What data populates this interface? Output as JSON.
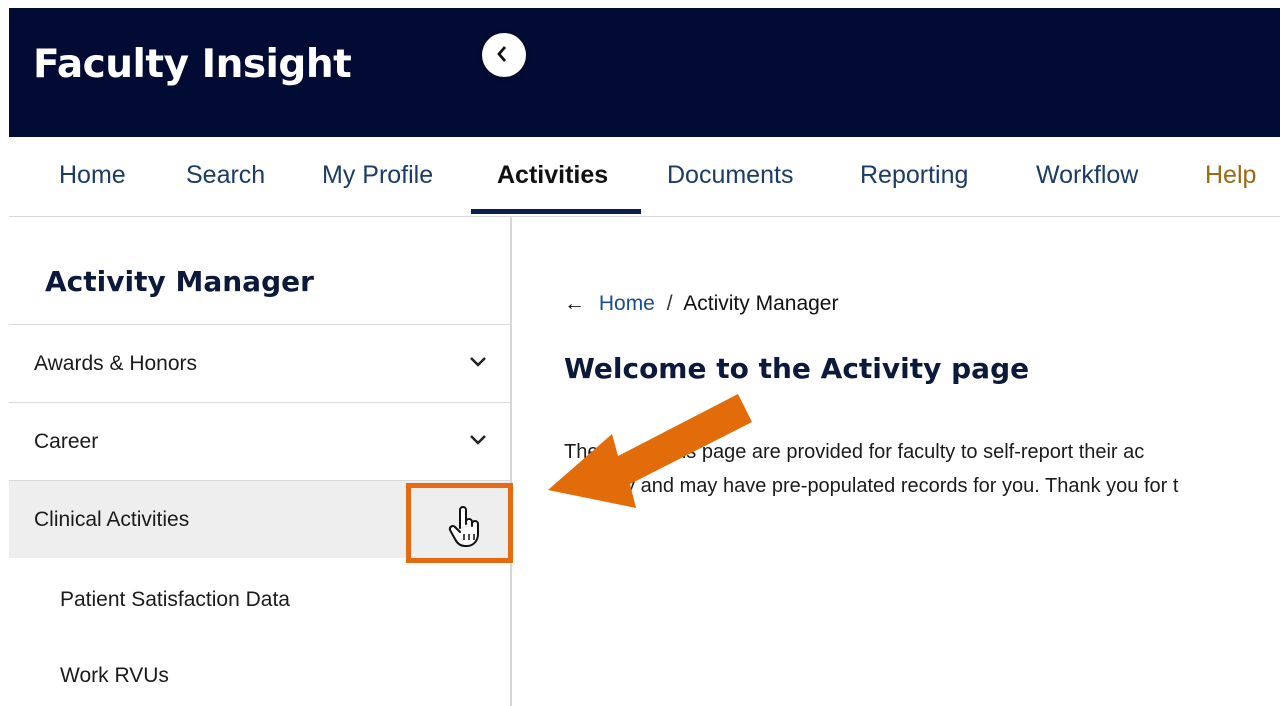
{
  "app": {
    "title": "Faculty Insight"
  },
  "nav": {
    "items": [
      {
        "label": "Home"
      },
      {
        "label": "Search"
      },
      {
        "label": "My Profile"
      },
      {
        "label": "Activities"
      },
      {
        "label": "Documents"
      },
      {
        "label": "Reporting"
      },
      {
        "label": "Workflow"
      },
      {
        "label": "Help"
      }
    ],
    "active": "Activities"
  },
  "sidebar": {
    "title": "Activity Manager",
    "collapse_icon": "chevron-left-icon",
    "items": [
      {
        "label": "Awards & Honors",
        "icon": "chevron-down-icon"
      },
      {
        "label": "Career",
        "icon": "chevron-down-icon"
      },
      {
        "label": "Clinical Activities",
        "icon": "hand-pointer-icon"
      }
    ],
    "subitems": [
      {
        "label": "Patient Satisfaction Data"
      },
      {
        "label": "Work RVUs"
      }
    ]
  },
  "breadcrumb": {
    "back_icon": "←",
    "home": "Home",
    "separator": "/",
    "current": "Activity Manager"
  },
  "main": {
    "heading": "Welcome to the Activity page",
    "intro_line1": "The f           his page are provided for faculty to self-report their ac",
    "intro_line2": "           y and may have pre-populated records for you. Thank you for t"
  },
  "colors": {
    "banner": "#020b33",
    "nav_link": "#1a3c66",
    "help_link": "#9a6a17",
    "annotation": "#e66a12",
    "selected_row": "#eeeeee"
  }
}
